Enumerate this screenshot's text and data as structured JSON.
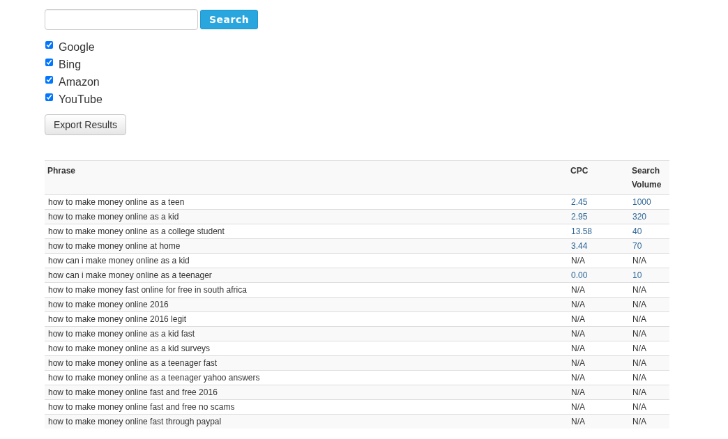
{
  "search": {
    "button": "Search"
  },
  "engines": [
    {
      "label": "Google",
      "checked": true
    },
    {
      "label": "Bing",
      "checked": true
    },
    {
      "label": "Amazon",
      "checked": true
    },
    {
      "label": "YouTube",
      "checked": true
    }
  ],
  "export_button": "Export Results",
  "table": {
    "columns": [
      "Phrase",
      "CPC",
      "Search Volume"
    ],
    "rows": [
      {
        "phrase": "how to make money online as a teen",
        "cpc": "2.45",
        "volume": "1000",
        "linked": true
      },
      {
        "phrase": "how to make money online as a kid",
        "cpc": "2.95",
        "volume": "320",
        "linked": true
      },
      {
        "phrase": "how to make money online as a college student",
        "cpc": "13.58",
        "volume": "40",
        "linked": true
      },
      {
        "phrase": "how to make money online at home",
        "cpc": "3.44",
        "volume": "70",
        "linked": true
      },
      {
        "phrase": "how can i make money online as a kid",
        "cpc": "N/A",
        "volume": "N/A",
        "linked": false
      },
      {
        "phrase": "how can i make money online as a teenager",
        "cpc": "0.00",
        "volume": "10",
        "linked": true
      },
      {
        "phrase": "how to make money fast online for free in south africa",
        "cpc": "N/A",
        "volume": "N/A",
        "linked": false
      },
      {
        "phrase": "how to make money online 2016",
        "cpc": "N/A",
        "volume": "N/A",
        "linked": false
      },
      {
        "phrase": "how to make money online 2016 legit",
        "cpc": "N/A",
        "volume": "N/A",
        "linked": false
      },
      {
        "phrase": "how to make money online as a kid fast",
        "cpc": "N/A",
        "volume": "N/A",
        "linked": false
      },
      {
        "phrase": "how to make money online as a kid surveys",
        "cpc": "N/A",
        "volume": "N/A",
        "linked": false
      },
      {
        "phrase": "how to make money online as a teenager fast",
        "cpc": "N/A",
        "volume": "N/A",
        "linked": false
      },
      {
        "phrase": "how to make money online as a teenager yahoo answers",
        "cpc": "N/A",
        "volume": "N/A",
        "linked": false
      },
      {
        "phrase": "how to make money online fast and free 2016",
        "cpc": "N/A",
        "volume": "N/A",
        "linked": false
      },
      {
        "phrase": "how to make money online fast and free no scams",
        "cpc": "N/A",
        "volume": "N/A",
        "linked": false
      },
      {
        "phrase": "how to make money online fast through paypal",
        "cpc": "N/A",
        "volume": "N/A",
        "linked": false
      }
    ]
  }
}
